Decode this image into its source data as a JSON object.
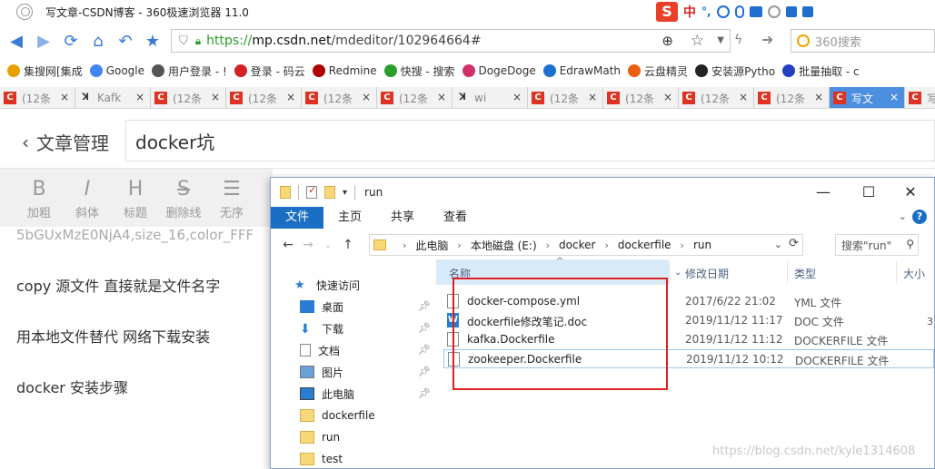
{
  "browser": {
    "window_title": "写文章-CSDN博客 - 360极速浏览器 11.0",
    "ime": {
      "lang": "中"
    },
    "url": {
      "scheme": "https://",
      "host": "mp.csdn.net",
      "path": "/mdeditor/102964664#"
    },
    "search_placeholder": "360搜索",
    "bookmarks": [
      {
        "label": "集搜网[集成",
        "color": "#e8a000"
      },
      {
        "label": "Google",
        "color": "#4285f4"
      },
      {
        "label": "用户登录 - !",
        "color": "#555555"
      },
      {
        "label": "登录 - 码云",
        "color": "#d22222"
      },
      {
        "label": "Redmine",
        "color": "#b00000"
      },
      {
        "label": "快搜 - 搜索",
        "color": "#2a9d2a"
      },
      {
        "label": "DogeDoge",
        "color": "#d0306a"
      },
      {
        "label": "EdrawMath",
        "color": "#1e6fd0"
      },
      {
        "label": "云盘精灵",
        "color": "#e86010"
      },
      {
        "label": "安装源Pytho",
        "color": "#222222"
      },
      {
        "label": "批量抽取 - c",
        "color": "#2040c0"
      }
    ],
    "tabs": [
      {
        "label": "(12条",
        "icon": "csdn",
        "active": false
      },
      {
        "label": "Kafk",
        "icon": "k",
        "active": false
      },
      {
        "label": "(12条",
        "icon": "csdn",
        "active": false
      },
      {
        "label": "(12条",
        "icon": "csdn",
        "active": false
      },
      {
        "label": "(12条",
        "icon": "csdn",
        "active": false
      },
      {
        "label": "(12条",
        "icon": "csdn",
        "active": false
      },
      {
        "label": "wi",
        "icon": "k",
        "active": false
      },
      {
        "label": "(12条",
        "icon": "csdn",
        "active": false
      },
      {
        "label": "(12条",
        "icon": "csdn",
        "active": false
      },
      {
        "label": "(12条",
        "icon": "csdn",
        "active": false
      },
      {
        "label": "(12条",
        "icon": "csdn",
        "active": false
      },
      {
        "label": "写文",
        "icon": "csdn",
        "active": true
      },
      {
        "label": "写",
        "icon": "csdn",
        "active": false
      }
    ]
  },
  "editor": {
    "back_label": "文章管理",
    "title_value": "docker坑",
    "toolbar": [
      {
        "glyph": "B",
        "label": "加粗"
      },
      {
        "glyph": "I",
        "label": "斜体"
      },
      {
        "glyph": "H",
        "label": "标题"
      },
      {
        "glyph": "S",
        "label": "删除线"
      },
      {
        "glyph": "☰",
        "label": "无序"
      }
    ],
    "cut_line": "5bGUxMzE0NjA4,size_16,color_FFF",
    "lines": [
      "copy 源文件 直接就是文件名字",
      "用本地文件替代  网络下载安装",
      "docker 安装步骤"
    ]
  },
  "explorer": {
    "window_title": "run",
    "ribbon_tabs": [
      "文件",
      "主页",
      "共享",
      "查看"
    ],
    "breadcrumb": [
      "此电脑",
      "本地磁盘 (E:)",
      "docker",
      "dockerfile",
      "run"
    ],
    "search_placeholder": "搜索\"run\"",
    "nav_items": [
      {
        "label": "快速访问",
        "icon": "star-icon",
        "pinned": false
      },
      {
        "label": "桌面",
        "icon": "desktop-icon",
        "pinned": true
      },
      {
        "label": "下载",
        "icon": "download-icon",
        "pinned": true
      },
      {
        "label": "文档",
        "icon": "document-icon",
        "pinned": true
      },
      {
        "label": "图片",
        "icon": "picture-icon",
        "pinned": true
      },
      {
        "label": "此电脑",
        "icon": "computer-icon",
        "pinned": true
      },
      {
        "label": "dockerfile",
        "icon": "folder-icon",
        "pinned": false
      },
      {
        "label": "run",
        "icon": "folder-icon",
        "pinned": false
      },
      {
        "label": "test",
        "icon": "folder-icon",
        "pinned": false
      }
    ],
    "columns": {
      "name": "名称",
      "date": "修改日期",
      "type": "类型",
      "size": "大小"
    },
    "files": [
      {
        "name": "docker-compose.yml",
        "date": "2017/6/22 21:02",
        "type": "YML 文件",
        "icon": "file-icon"
      },
      {
        "name": "dockerfile修改笔记.doc",
        "date": "2019/11/12 11:17",
        "type": "DOC 文件",
        "icon": "word-icon"
      },
      {
        "name": "kafka.Dockerfile",
        "date": "2019/11/12 11:12",
        "type": "DOCKERFILE 文件",
        "icon": "file-icon"
      },
      {
        "name": "zookeeper.Dockerfile",
        "date": "2019/11/12 10:12",
        "type": "DOCKERFILE 文件",
        "icon": "file-icon"
      }
    ],
    "size_col_fragment": "3"
  },
  "watermark": "https://blog.csdn.net/kyle1314608",
  "colors": {
    "accent": "#1a6fc4",
    "highlight_box": "#e02020",
    "csdn": "#d32222"
  }
}
